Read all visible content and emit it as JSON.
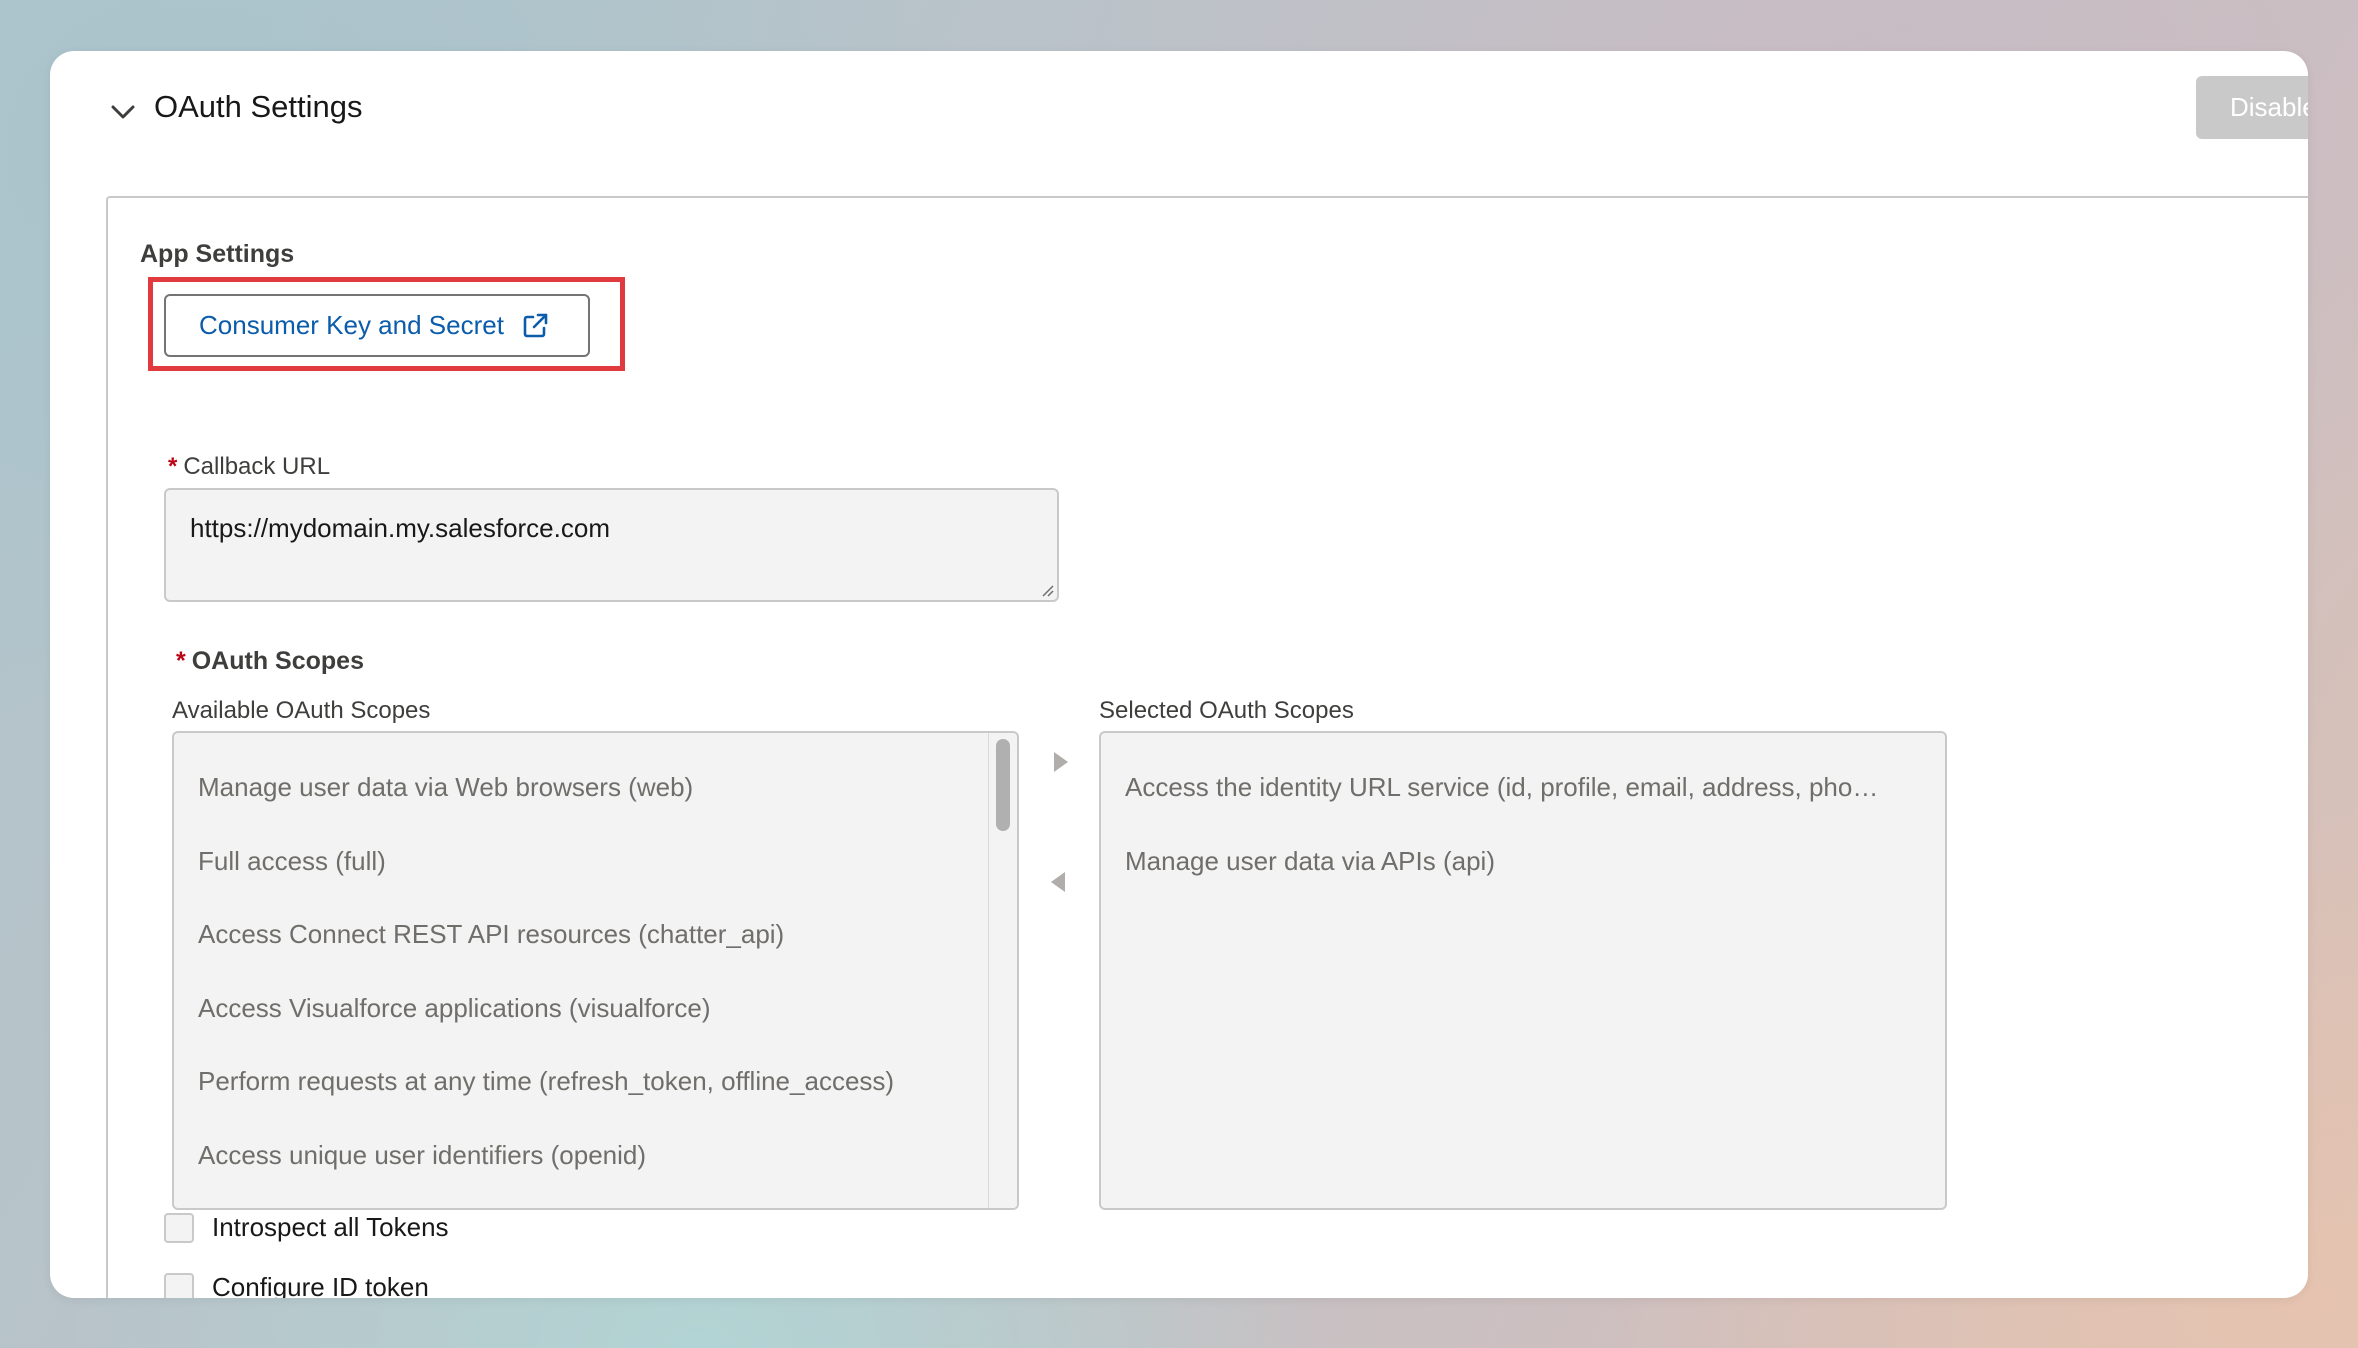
{
  "section": {
    "title": "OAuth Settings",
    "disable_button_label": "Disable"
  },
  "app_settings": {
    "label": "App Settings",
    "consumer_key_button_label": "Consumer Key and Secret"
  },
  "callback": {
    "required_marker": "*",
    "label": "Callback URL",
    "value": "https://mydomain.my.salesforce.com"
  },
  "oauth_scopes": {
    "required_marker": "*",
    "title": "OAuth Scopes",
    "available_label": "Available OAuth Scopes",
    "selected_label": "Selected OAuth Scopes",
    "available": [
      "Manage user data via Web browsers (web)",
      "Full access (full)",
      "Access Connect REST API resources (chatter_api)",
      "Access Visualforce applications (visualforce)",
      "Perform requests at any time (refresh_token, offline_access)",
      "Access unique user identifiers (openid)"
    ],
    "selected": [
      "Access the identity URL service (id, profile, email, address, pho…",
      "Manage user data via APIs (api)"
    ]
  },
  "checkboxes": {
    "introspect_label": "Introspect all Tokens",
    "configure_id_label": "Configure ID token"
  },
  "colors": {
    "link_blue": "#0b5cab",
    "required_red": "#ba0517",
    "highlight_red": "#e03a3e",
    "disabled_button_gray": "#c9c9c9"
  }
}
